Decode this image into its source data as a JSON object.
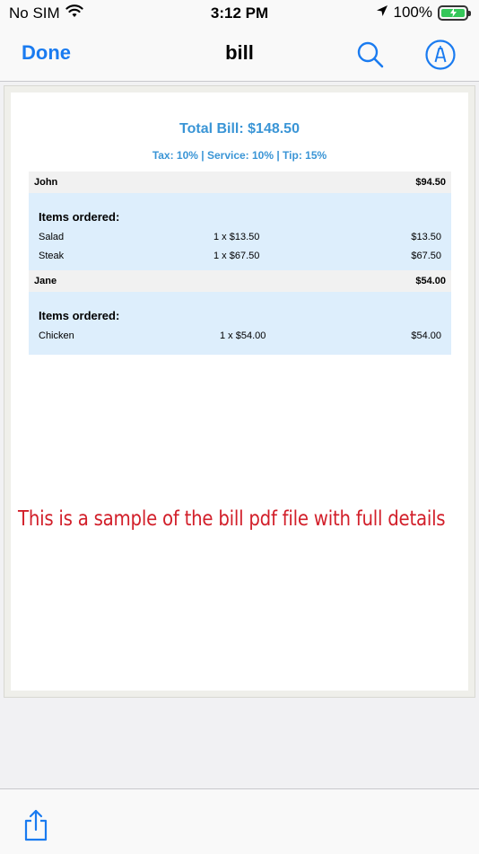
{
  "status_bar": {
    "carrier": "No SIM",
    "time": "3:12 PM",
    "battery": "100%",
    "icons": [
      "wifi-icon",
      "location-arrow-icon",
      "battery-charging-icon"
    ]
  },
  "nav": {
    "done_label": "Done",
    "title": "bill",
    "icons": [
      "search-icon",
      "markup-pen-icon"
    ],
    "accent_color": "#1a7bf0"
  },
  "document": {
    "total_title": "Total Bill: $148.50",
    "rates": "Tax: 10% | Service: 10% | Tip: 15%",
    "people": [
      {
        "name": "John",
        "total": "$94.50",
        "items_heading": "Items ordered:",
        "items": [
          {
            "name": "Salad",
            "qty": "1 x $13.50",
            "price": "$13.50"
          },
          {
            "name": "Steak",
            "qty": "1 x $67.50",
            "price": "$67.50"
          }
        ]
      },
      {
        "name": "Jane",
        "total": "$54.00",
        "items_heading": "Items ordered:",
        "items": [
          {
            "name": "Chicken",
            "qty": "1 x $54.00",
            "price": "$54.00"
          }
        ]
      }
    ],
    "sample_note": "This is a sample of the bill pdf file with full details",
    "colors": {
      "header_blue": "#3a95d6",
      "items_bg": "#ddeefc",
      "note_red": "#d21f2a"
    }
  },
  "bottom_bar": {
    "icons": [
      "share-icon"
    ]
  }
}
